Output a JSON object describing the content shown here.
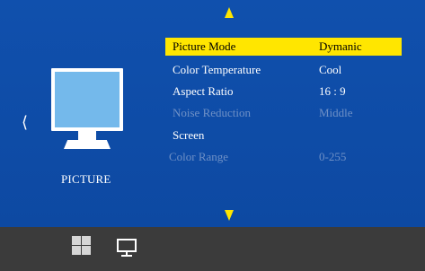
{
  "nav": {
    "up_icon": "triangle-up-icon",
    "down_icon": "triangle-down-icon",
    "left_icon": "chevron-left",
    "left_glyph": "⟨"
  },
  "panel": {
    "title": "PICTURE",
    "icon": "monitor-icon"
  },
  "menu": {
    "items": [
      {
        "label": "Picture Mode",
        "value": "Dymanic",
        "state": "selected"
      },
      {
        "label": "Color Temperature",
        "value": "Cool",
        "state": "normal"
      },
      {
        "label": "Aspect Ratio",
        "value": "16 : 9",
        "state": "normal"
      },
      {
        "label": "Noise Reduction",
        "value": "Middle",
        "state": "disabled"
      },
      {
        "label": "Screen",
        "value": "",
        "state": "normal"
      },
      {
        "label": "Color Range",
        "value": "0-255",
        "state": "disabled"
      }
    ]
  },
  "footer": {
    "icons": [
      "grid-icon",
      "monitor-icon"
    ]
  },
  "colors": {
    "background": "#0f4aa3",
    "highlight": "#ffe600",
    "footer": "#3b3b3b",
    "disabled_text": "#6e90c6"
  }
}
